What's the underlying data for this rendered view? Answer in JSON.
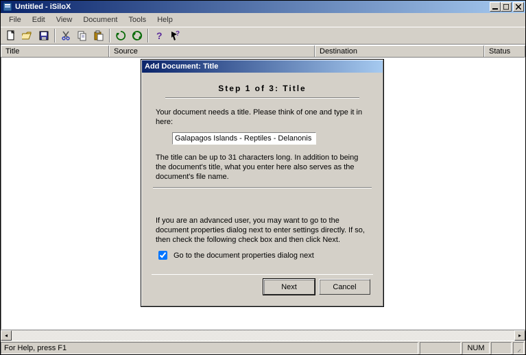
{
  "titlebar": {
    "text": "Untitled - iSiloX"
  },
  "menubar": [
    "File",
    "Edit",
    "View",
    "Document",
    "Tools",
    "Help"
  ],
  "columns": {
    "title": "Title",
    "source": "Source",
    "destination": "Destination",
    "status": "Status"
  },
  "statusbar": {
    "help": "For Help, press F1",
    "num": "NUM"
  },
  "dialog": {
    "title": "Add Document: Title",
    "step": "Step 1 of 3: Title",
    "prompt": "Your document needs a title. Please think of one and type it in here:",
    "input_value": "Galapagos Islands - Reptiles - Delanonis",
    "note": "The title can be up to 31 characters long. In addition to being the document's title, what you enter here also serves as the document's file name.",
    "advanced": "If you are an advanced user, you may want to go to the document properties dialog next to enter settings directly. If so, then check the following check box and then click Next.",
    "checkbox_label": "Go to the document properties dialog next",
    "checkbox_checked": true,
    "next": "Next",
    "cancel": "Cancel"
  },
  "icons": {
    "new": "new",
    "open": "open",
    "save": "save",
    "cut": "cut",
    "copy": "copy",
    "paste": "paste",
    "refresh1": "refresh",
    "refresh2": "refresh-all",
    "help": "help",
    "whatsthis": "whats-this"
  }
}
